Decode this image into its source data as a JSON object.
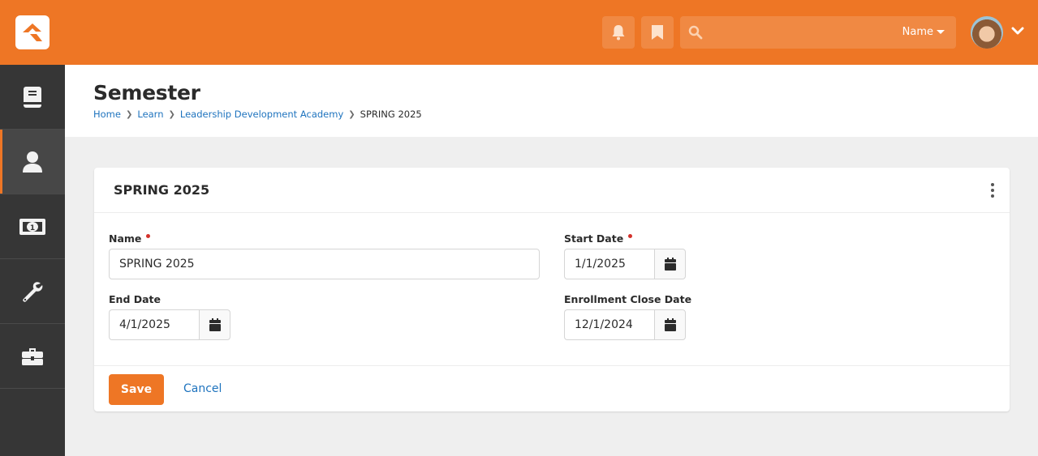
{
  "topbar": {
    "logo": "rock-logo",
    "notifications_icon": "bell-icon",
    "bookmarks_icon": "bookmark-icon",
    "search": {
      "placeholder": "",
      "value": "",
      "filter_label": "Name"
    },
    "user_menu_icon": "chevron-down-icon"
  },
  "sidebar": {
    "items": [
      {
        "icon": "book-icon",
        "active": false
      },
      {
        "icon": "user-icon",
        "active": true
      },
      {
        "icon": "money-icon",
        "active": false
      },
      {
        "icon": "wrench-icon",
        "active": false
      },
      {
        "icon": "briefcase-icon",
        "active": false
      }
    ]
  },
  "page": {
    "title": "Semester",
    "breadcrumb": [
      {
        "label": "Home"
      },
      {
        "label": "Learn"
      },
      {
        "label": "Leadership Development Academy"
      },
      {
        "label": "SPRING 2025"
      }
    ]
  },
  "panel": {
    "title": "SPRING 2025",
    "fields": {
      "name": {
        "label": "Name",
        "value": "SPRING 2025",
        "required": true
      },
      "start_date": {
        "label": "Start Date",
        "value": "1/1/2025",
        "required": true
      },
      "end_date": {
        "label": "End Date",
        "value": "4/1/2025",
        "required": false
      },
      "enrollment_close_date": {
        "label": "Enrollment Close Date",
        "value": "12/1/2024",
        "required": false
      }
    },
    "save_label": "Save",
    "cancel_label": "Cancel"
  },
  "colors": {
    "brand": "#ee7625",
    "sidebar": "#363636",
    "link": "#1e73be",
    "required": "#d4312b"
  }
}
